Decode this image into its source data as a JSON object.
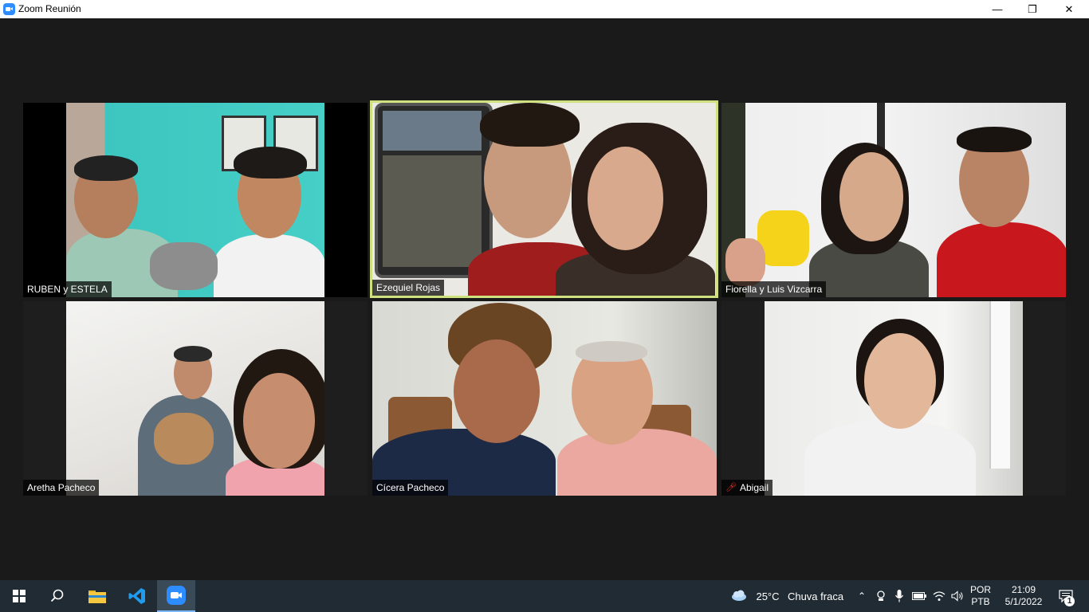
{
  "window": {
    "title": "Zoom Reunión",
    "minimize_glyph": "—",
    "restore_glyph": "❐",
    "close_glyph": "✕"
  },
  "participants": [
    {
      "name": "RUBEN y ESTELA",
      "muted": false,
      "active_speaker": false
    },
    {
      "name": "Ezequiel Rojas",
      "muted": false,
      "active_speaker": true
    },
    {
      "name": "Fiorella y Luis Vizcarra",
      "muted": false,
      "active_speaker": false
    },
    {
      "name": "Aretha Pacheco",
      "muted": false,
      "active_speaker": false
    },
    {
      "name": "Cícera Pacheco",
      "muted": false,
      "active_speaker": false
    },
    {
      "name": "Abigail",
      "muted": true,
      "active_speaker": false
    }
  ],
  "taskbar": {
    "apps": [
      "windows-start-icon",
      "search-icon",
      "file-explorer-icon",
      "vscode-icon",
      "zoom-icon"
    ],
    "weather": {
      "temperature": "25°C",
      "condition": "Chuva fraca"
    },
    "language": {
      "top": "POR",
      "bottom": "PTB"
    },
    "clock": {
      "time": "21:09",
      "date": "5/1/2022"
    },
    "notification_count": "1"
  },
  "colors": {
    "active_speaker_border": "#cfe07e",
    "taskbar_bg": "#202b33",
    "meeting_bg": "#1a1a1a",
    "zoom_blue": "#2d8cff",
    "mute_red": "#e0322b"
  }
}
